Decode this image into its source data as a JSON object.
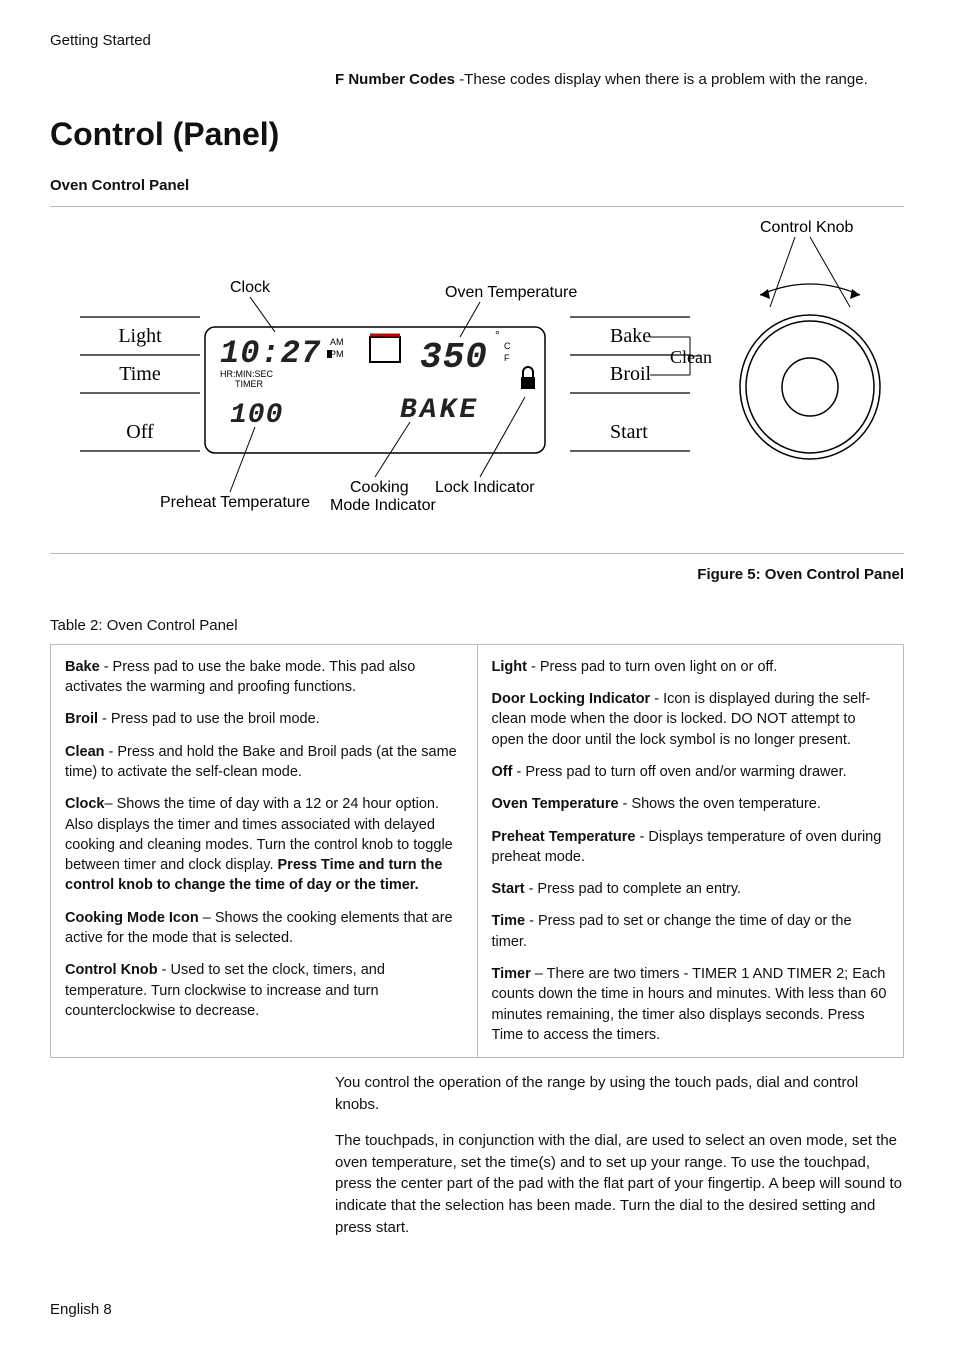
{
  "header": {
    "section": "Getting Started"
  },
  "intro": {
    "bold": "F Number Codes ",
    "rest": "-These codes display when there is a problem with the range."
  },
  "title": "Control (Panel)",
  "subhead": "Oven Control Panel",
  "diagram": {
    "labels": {
      "control_knob": "Control Knob",
      "clock": "Clock",
      "oven_temp": "Oven Temperature",
      "preheat_temp": "Preheat Temperature",
      "cooking_mode_l1": "Cooking",
      "cooking_mode_l2": "Mode Indicator",
      "lock_indicator": "Lock Indicator"
    },
    "left_buttons": [
      "Light",
      "Time",
      "Off"
    ],
    "right_buttons": [
      "Bake",
      "Broil",
      "Start"
    ],
    "clean": "Clean",
    "display": {
      "time": "10:27",
      "am": "AM",
      "pm": "PM",
      "timer_label": "HR:MIN:SEC",
      "timer_label2": "TIMER",
      "preheat": "100",
      "temp": "350",
      "deg": "°",
      "C": "C",
      "F": "F",
      "mode": "BAKE"
    }
  },
  "figure_caption": "Figure 5: Oven Control Panel",
  "table_title": "Table 2: Oven Control Panel",
  "col1": {
    "bake_b": "Bake",
    "bake_t": " - Press pad to use the bake mode. This pad also activates the warming and proofing functions.",
    "broil_b": "Broil",
    "broil_t": " - Press pad to use the broil mode.",
    "clean_b": "Clean",
    "clean_t": " - Press and hold the Bake and Broil pads (at the same time) to activate the self-clean mode.",
    "clock_b": "Clock",
    "clock_t": "– Shows the time of day with a 12 or 24 hour option. Also displays the timer and times associated with delayed cooking and cleaning modes. Turn the control knob to toggle between timer and clock display. ",
    "clock_b2": "Press Time and turn the control knob to change the time of day or the timer.",
    "cook_b": "Cooking Mode Icon",
    "cook_t": " – Shows the cooking elements that are active for the mode that is selected.",
    "knob_b": "Control Knob",
    "knob_t": " - Used to set the clock, timers, and temperature. Turn clockwise to increase and turn counterclockwise to decrease."
  },
  "col2": {
    "light_b": "Light",
    "light_t": " - Press pad to turn oven light on or off.",
    "door_b": "Door Locking Indicator",
    "door_t": " - Icon is displayed during the self-clean mode when the door is locked. DO NOT attempt to open the door until the lock symbol is no longer present.",
    "off_b": "Off",
    "off_t": " - Press pad to turn off oven and/or warming drawer.",
    "otemp_b": "Oven Temperature",
    "otemp_t": " - Shows the oven temperature.",
    "pre_b": "Preheat Temperature",
    "pre_t": " - Displays temperature of oven during preheat mode.",
    "start_b": "Start",
    "start_t": " - Press pad to complete an entry.",
    "time_b": "Time",
    "time_t": " - Press pad to set or change the time of day or the timer.",
    "timer_b": "Timer",
    "timer_t": " – There are two timers - TIMER 1 AND TIMER 2; Each counts down the time in hours and minutes. With less than 60 minutes remaining, the timer also displays seconds. Press Time to access the timers."
  },
  "para1": "You control the operation of the range by using the touch pads, dial and control knobs.",
  "para2": "The touchpads, in conjunction with the dial, are used to select an oven mode, set the oven temperature, set the time(s) and to set up your range. To use the touchpad, press the center part of the pad with the flat part of your fingertip. A beep will sound to indicate that the selection has been made. Turn the dial to the desired setting and press start.",
  "footer": "English 8"
}
